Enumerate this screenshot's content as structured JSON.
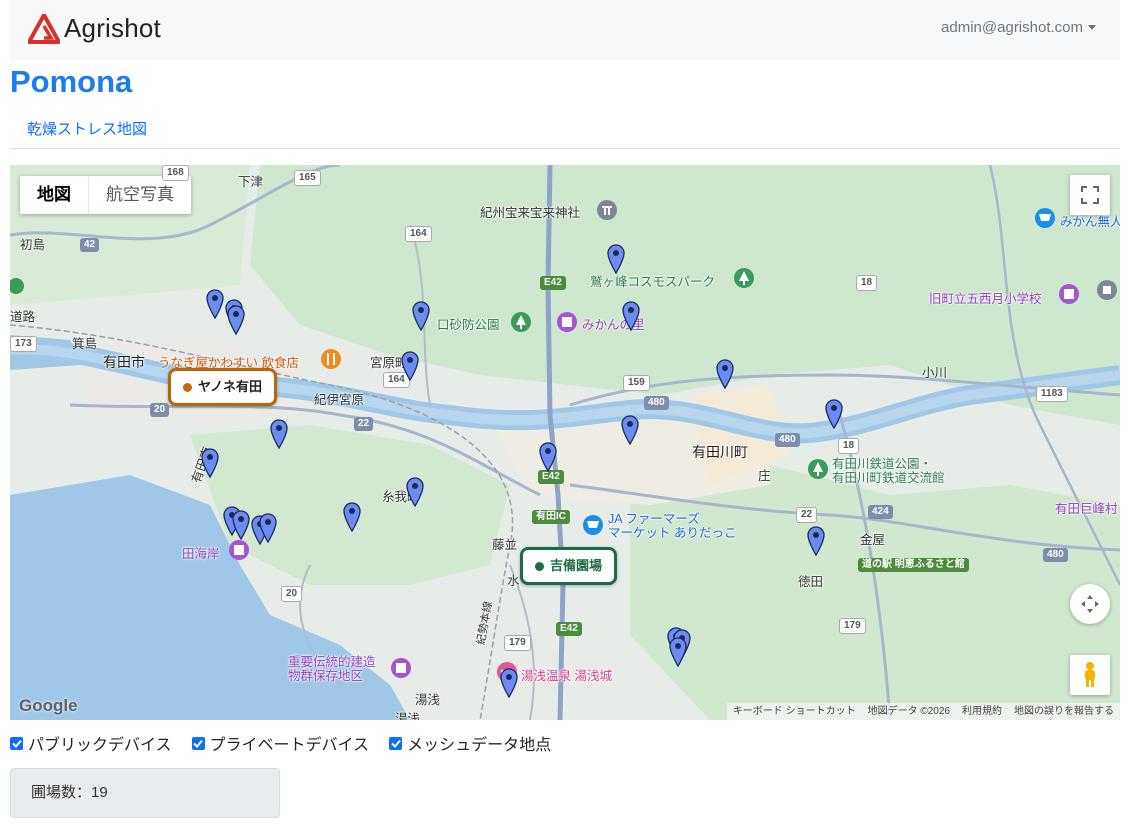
{
  "header": {
    "brand": "Agrishot",
    "user_email": "admin@agrishot.com"
  },
  "page": {
    "title": "Pomona",
    "tab_label": "乾燥ストレス地図"
  },
  "map": {
    "type_buttons": {
      "map": "地図",
      "satellite": "航空写真"
    },
    "farm_labels": [
      {
        "name": "ヤノネ有田",
        "color": "#b8660a"
      },
      {
        "name": "吉備園場",
        "color": "#1f6b45"
      }
    ],
    "place_labels": {
      "arida_city": "有田市",
      "aridagawa_town": "有田川町",
      "shimotsu": "下津",
      "hatsushima": "初島",
      "minoshima": "箕島",
      "miyahara": "宮原町",
      "kii_miyahara": "紀伊宮原",
      "itoga": "糸我町",
      "fujinami": "藤並",
      "yuasa": "湯浅",
      "yuasa2": "湯浅",
      "kanaya": "金屋",
      "tokuda": "徳田",
      "kogawa": "小川",
      "sho": "庄",
      "arida_minami": "有田南",
      "mizu": "水",
      "douro": "道路"
    },
    "poi_labels": {
      "shrine": "紀州宝来宝来神社",
      "cosmos": "鷲ヶ峰コスモスパーク",
      "sabo": "口砂防公園",
      "mikan_no": "みかんの里",
      "restaurant": "うなぎ屋かわすい 飲食店",
      "ja_market": "JA ファーマーズ\nマーケット ありだっこ",
      "railway_park": "有田川鉄道公園・\n有田川町鉄道交流館",
      "school": "旧町立五西月小学校",
      "mikan_museum": "みかん無人",
      "tashima": "田海岸",
      "preservation": "重要伝統的建造\n物群保存地区",
      "onsen": "湯浅温泉 湯浅城",
      "michinoeki": "道の駅 明恵ふるさと館",
      "arida_c": "有田巨峰村",
      "arida_ic": "有田IC",
      "kiseiline": "紀勢本線"
    },
    "roads": [
      "165",
      "42",
      "164",
      "164",
      "159",
      "480",
      "480",
      "480",
      "22",
      "22",
      "20",
      "20",
      "179",
      "179",
      "424",
      "18",
      "18",
      "1183",
      "173",
      "168",
      "E42",
      "E42",
      "E42"
    ],
    "attribution": [
      "キーボード ショートカット",
      "地図データ ©2026",
      "利用規約",
      "地図の誤りを報告する"
    ],
    "google_logo": "Google"
  },
  "filters": {
    "public": "パブリックデバイス",
    "private": "プライベートデバイス",
    "mesh": "メッシュデータ地点"
  },
  "summary": {
    "farm_count": "圃場数：19"
  },
  "colors": {
    "accent": "#0d6efd",
    "marker": "#6b8cf2",
    "brand_red": "#d9302c"
  }
}
